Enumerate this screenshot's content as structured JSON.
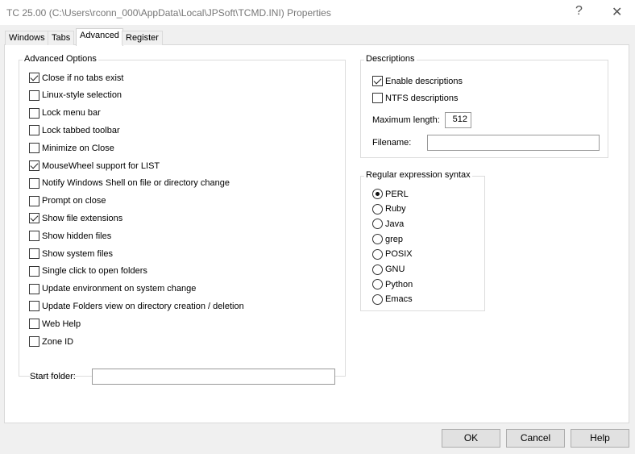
{
  "window": {
    "title": "TC 25.00  (C:\\Users\\rconn_000\\AppData\\Local\\JPSoft\\TCMD.INI)  Properties",
    "help_glyph": "?",
    "close_glyph": "✕"
  },
  "tabs": [
    {
      "label": "Windows",
      "active": false
    },
    {
      "label": "Tabs",
      "active": false
    },
    {
      "label": "Advanced",
      "active": true
    },
    {
      "label": "Register",
      "active": false
    }
  ],
  "advanced": {
    "label": "Advanced Options",
    "options": [
      {
        "label": "Close if no tabs exist",
        "checked": true
      },
      {
        "label": "Linux-style selection",
        "checked": false
      },
      {
        "label": "Lock menu bar",
        "checked": false
      },
      {
        "label": "Lock tabbed toolbar",
        "checked": false
      },
      {
        "label": "Minimize on Close",
        "checked": false
      },
      {
        "label": "MouseWheel support for LIST",
        "checked": true
      },
      {
        "label": "Notify Windows Shell on file or directory change",
        "checked": false
      },
      {
        "label": "Prompt on close",
        "checked": false
      },
      {
        "label": "Show file extensions",
        "checked": true
      },
      {
        "label": "Show hidden files",
        "checked": false
      },
      {
        "label": "Show system files",
        "checked": false
      },
      {
        "label": "Single click to open folders",
        "checked": false
      },
      {
        "label": "Update environment on system change",
        "checked": false
      },
      {
        "label": "Update Folders view on directory creation / deletion",
        "checked": false
      },
      {
        "label": "Web Help",
        "checked": false
      },
      {
        "label": "Zone ID",
        "checked": false
      }
    ],
    "start_folder_label": "Start folder:",
    "start_folder_value": ""
  },
  "descriptions": {
    "label": "Descriptions",
    "enable": {
      "label": "Enable descriptions",
      "checked": true
    },
    "ntfs": {
      "label": "NTFS descriptions",
      "checked": false
    },
    "max_length_label": "Maximum length:",
    "max_length_value": "512",
    "filename_label": "Filename:",
    "filename_value": ""
  },
  "regex": {
    "label": "Regular expression syntax",
    "selected": "PERL",
    "options": [
      "PERL",
      "Ruby",
      "Java",
      "grep",
      "POSIX",
      "GNU",
      "Python",
      "Emacs"
    ]
  },
  "buttons": {
    "ok": "OK",
    "cancel": "Cancel",
    "help": "Help"
  }
}
